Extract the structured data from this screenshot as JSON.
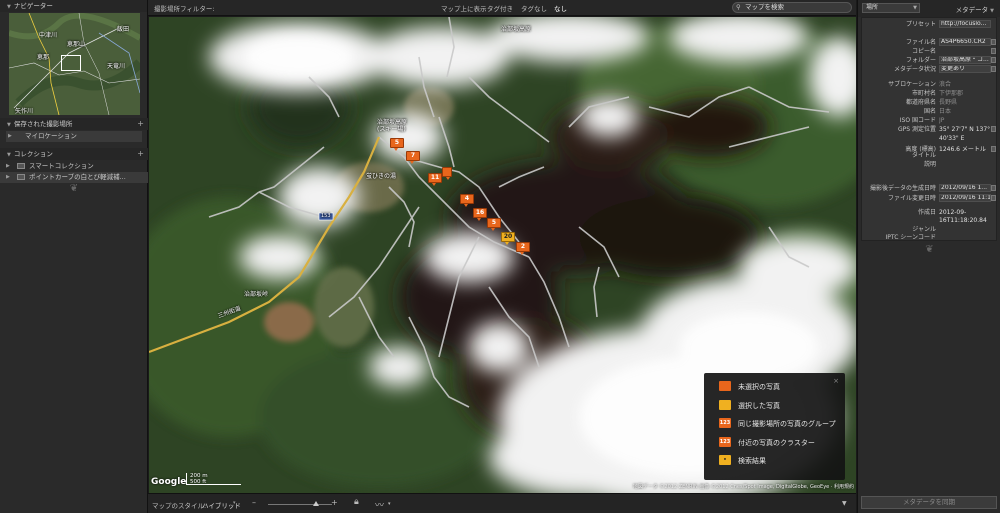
{
  "left": {
    "navigator": {
      "title": "ナビゲーター",
      "place_labels": [
        "中津川",
        "恵那山",
        "飯田",
        "恵那",
        "天竜川",
        "矢作川"
      ]
    },
    "saved": {
      "title": "保存された撮影場所",
      "items": [
        {
          "label": "マイロケーション"
        }
      ]
    },
    "collections": {
      "title": "コレクション",
      "items": [
        {
          "label": "スマートコレクション"
        },
        {
          "label": "ポイントカーブの白とび軽減補..."
        }
      ]
    }
  },
  "topbar": {
    "filter_label": "撮影場所フィルター:",
    "options": [
      "マップ上に表示",
      "タグ付き",
      "タグなし",
      "なし"
    ],
    "selected": "なし",
    "search_placeholder": "マップを検索"
  },
  "map": {
    "labels": [
      {
        "text": "治部坂高原"
      },
      {
        "text": "治部坂高原\n(スキー場)"
      },
      {
        "text": "蛍ひきの湯"
      },
      {
        "text": "153"
      },
      {
        "text": "治部坂峠"
      },
      {
        "text": "三州街道"
      }
    ],
    "markers": [
      {
        "label": "5",
        "color": "orange"
      },
      {
        "label": "7",
        "color": "orange"
      },
      {
        "label": "",
        "color": "orange"
      },
      {
        "label": "11",
        "color": "orange"
      },
      {
        "label": "4",
        "color": "orange"
      },
      {
        "label": "16",
        "color": "orange"
      },
      {
        "label": "5",
        "color": "orange"
      },
      {
        "label": "20",
        "color": "yellow"
      },
      {
        "label": "2",
        "color": "orange"
      }
    ],
    "scale": {
      "upper": "200 m",
      "lower": "500 ft"
    },
    "google": "Google",
    "attribution": "地図データ ©2012 ZENRIN 画像 ©2012 Cnes/Spot Image, DigitalGlobe, GeoEye · 利用規約"
  },
  "legend": {
    "items": [
      {
        "icon": "",
        "style": "o",
        "label": "未選択の写真"
      },
      {
        "icon": "",
        "style": "y",
        "label": "選択した写真"
      },
      {
        "icon": "123",
        "style": "o",
        "label": "同じ撮影場所の写真のグループ"
      },
      {
        "icon": "123",
        "style": "o",
        "label": "付近の写真のクラスター"
      },
      {
        "icon": "•",
        "style": "y",
        "label": "検索結果"
      }
    ],
    "close": "×"
  },
  "bottombar": {
    "style_label": "マップのスタイル:",
    "style_value": "ハイブリッド",
    "minus": "–",
    "plus": "+"
  },
  "right": {
    "preset_select": "場所",
    "title": "メタデータ",
    "rows": [
      {
        "k": "プリセット",
        "v": "http://focuslo..."
      },
      {
        "k": "ファイル名",
        "v": "AS4P6650.CR2"
      },
      {
        "k": "コピー名",
        "v": ""
      },
      {
        "k": "フォルダー",
        "v": "治部坂高原・コ..."
      },
      {
        "k": "メタデータ状況",
        "v": "変更あり"
      },
      {
        "k": "サブロケーション",
        "v": "浪合"
      },
      {
        "k": "市町村名",
        "v": "下伊那郡"
      },
      {
        "k": "都道府県名",
        "v": "長野県"
      },
      {
        "k": "国名",
        "v": "日本"
      },
      {
        "k": "ISO 国コード",
        "v": "JP"
      },
      {
        "k": "GPS 測定位置",
        "v": "35° 27'7\" N 137°"
      },
      {
        "k": "",
        "v": "40'33\" E"
      },
      {
        "k": "高度 (標高)",
        "v": "1246.6 メートル"
      },
      {
        "k": "タイトル",
        "v": ""
      },
      {
        "k": "説明",
        "v": ""
      },
      {
        "k": "撮影後データの生成日時",
        "v": "2012/09/16 1..."
      },
      {
        "k": "ファイル変更日時",
        "v": "2012/09/16 11:18..."
      },
      {
        "k": "作成日",
        "v": "2012-09-"
      },
      {
        "k": "",
        "v": "16T11:18:20.84"
      },
      {
        "k": "ジャンル",
        "v": ""
      },
      {
        "k": "IPTC シーンコード",
        "v": ""
      }
    ],
    "sync_button": "メタデータを同期"
  }
}
